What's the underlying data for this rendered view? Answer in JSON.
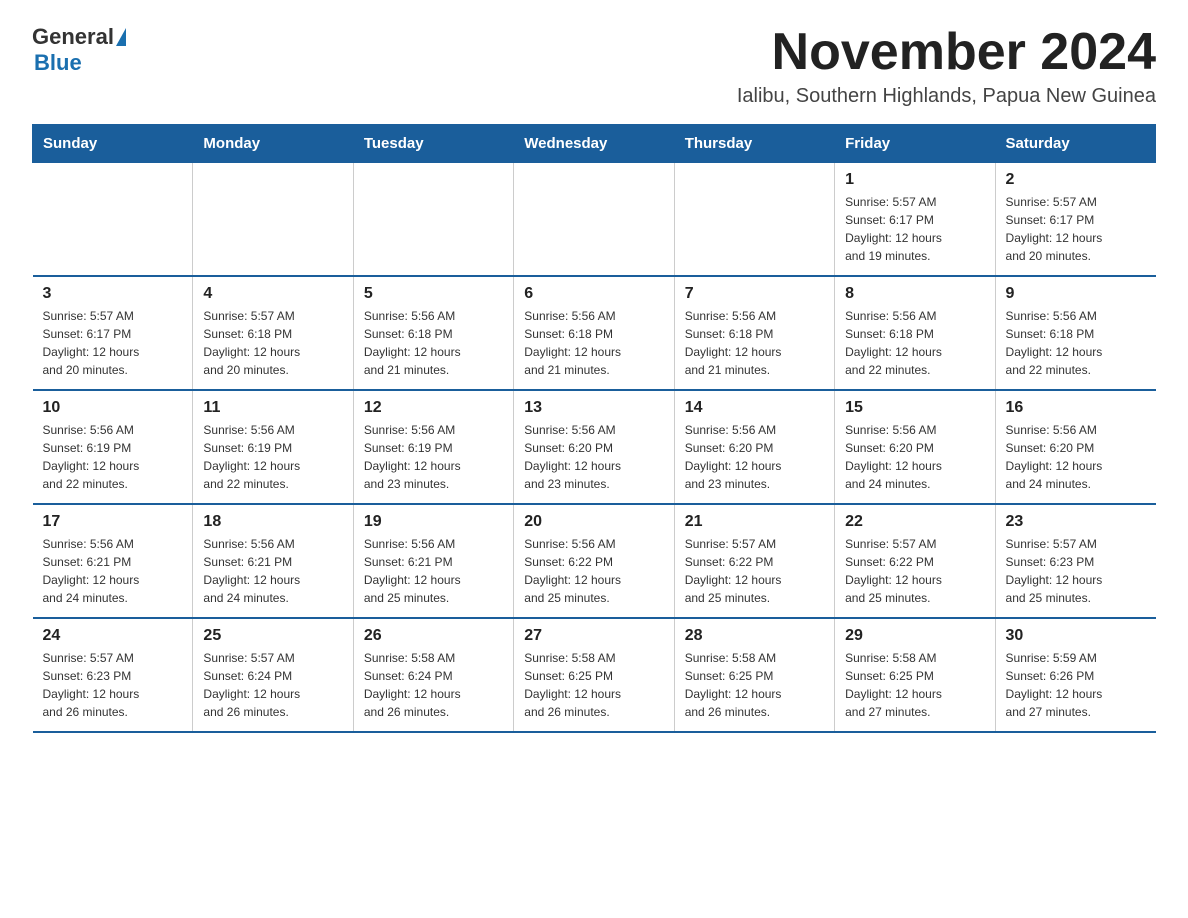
{
  "header": {
    "title": "November 2024",
    "subtitle": "Ialibu, Southern Highlands, Papua New Guinea",
    "logo_general": "General",
    "logo_blue": "Blue"
  },
  "weekdays": [
    "Sunday",
    "Monday",
    "Tuesday",
    "Wednesday",
    "Thursday",
    "Friday",
    "Saturday"
  ],
  "weeks": [
    {
      "days": [
        {
          "number": "",
          "info": ""
        },
        {
          "number": "",
          "info": ""
        },
        {
          "number": "",
          "info": ""
        },
        {
          "number": "",
          "info": ""
        },
        {
          "number": "",
          "info": ""
        },
        {
          "number": "1",
          "info": "Sunrise: 5:57 AM\nSunset: 6:17 PM\nDaylight: 12 hours\nand 19 minutes."
        },
        {
          "number": "2",
          "info": "Sunrise: 5:57 AM\nSunset: 6:17 PM\nDaylight: 12 hours\nand 20 minutes."
        }
      ]
    },
    {
      "days": [
        {
          "number": "3",
          "info": "Sunrise: 5:57 AM\nSunset: 6:17 PM\nDaylight: 12 hours\nand 20 minutes."
        },
        {
          "number": "4",
          "info": "Sunrise: 5:57 AM\nSunset: 6:18 PM\nDaylight: 12 hours\nand 20 minutes."
        },
        {
          "number": "5",
          "info": "Sunrise: 5:56 AM\nSunset: 6:18 PM\nDaylight: 12 hours\nand 21 minutes."
        },
        {
          "number": "6",
          "info": "Sunrise: 5:56 AM\nSunset: 6:18 PM\nDaylight: 12 hours\nand 21 minutes."
        },
        {
          "number": "7",
          "info": "Sunrise: 5:56 AM\nSunset: 6:18 PM\nDaylight: 12 hours\nand 21 minutes."
        },
        {
          "number": "8",
          "info": "Sunrise: 5:56 AM\nSunset: 6:18 PM\nDaylight: 12 hours\nand 22 minutes."
        },
        {
          "number": "9",
          "info": "Sunrise: 5:56 AM\nSunset: 6:18 PM\nDaylight: 12 hours\nand 22 minutes."
        }
      ]
    },
    {
      "days": [
        {
          "number": "10",
          "info": "Sunrise: 5:56 AM\nSunset: 6:19 PM\nDaylight: 12 hours\nand 22 minutes."
        },
        {
          "number": "11",
          "info": "Sunrise: 5:56 AM\nSunset: 6:19 PM\nDaylight: 12 hours\nand 22 minutes."
        },
        {
          "number": "12",
          "info": "Sunrise: 5:56 AM\nSunset: 6:19 PM\nDaylight: 12 hours\nand 23 minutes."
        },
        {
          "number": "13",
          "info": "Sunrise: 5:56 AM\nSunset: 6:20 PM\nDaylight: 12 hours\nand 23 minutes."
        },
        {
          "number": "14",
          "info": "Sunrise: 5:56 AM\nSunset: 6:20 PM\nDaylight: 12 hours\nand 23 minutes."
        },
        {
          "number": "15",
          "info": "Sunrise: 5:56 AM\nSunset: 6:20 PM\nDaylight: 12 hours\nand 24 minutes."
        },
        {
          "number": "16",
          "info": "Sunrise: 5:56 AM\nSunset: 6:20 PM\nDaylight: 12 hours\nand 24 minutes."
        }
      ]
    },
    {
      "days": [
        {
          "number": "17",
          "info": "Sunrise: 5:56 AM\nSunset: 6:21 PM\nDaylight: 12 hours\nand 24 minutes."
        },
        {
          "number": "18",
          "info": "Sunrise: 5:56 AM\nSunset: 6:21 PM\nDaylight: 12 hours\nand 24 minutes."
        },
        {
          "number": "19",
          "info": "Sunrise: 5:56 AM\nSunset: 6:21 PM\nDaylight: 12 hours\nand 25 minutes."
        },
        {
          "number": "20",
          "info": "Sunrise: 5:56 AM\nSunset: 6:22 PM\nDaylight: 12 hours\nand 25 minutes."
        },
        {
          "number": "21",
          "info": "Sunrise: 5:57 AM\nSunset: 6:22 PM\nDaylight: 12 hours\nand 25 minutes."
        },
        {
          "number": "22",
          "info": "Sunrise: 5:57 AM\nSunset: 6:22 PM\nDaylight: 12 hours\nand 25 minutes."
        },
        {
          "number": "23",
          "info": "Sunrise: 5:57 AM\nSunset: 6:23 PM\nDaylight: 12 hours\nand 25 minutes."
        }
      ]
    },
    {
      "days": [
        {
          "number": "24",
          "info": "Sunrise: 5:57 AM\nSunset: 6:23 PM\nDaylight: 12 hours\nand 26 minutes."
        },
        {
          "number": "25",
          "info": "Sunrise: 5:57 AM\nSunset: 6:24 PM\nDaylight: 12 hours\nand 26 minutes."
        },
        {
          "number": "26",
          "info": "Sunrise: 5:58 AM\nSunset: 6:24 PM\nDaylight: 12 hours\nand 26 minutes."
        },
        {
          "number": "27",
          "info": "Sunrise: 5:58 AM\nSunset: 6:25 PM\nDaylight: 12 hours\nand 26 minutes."
        },
        {
          "number": "28",
          "info": "Sunrise: 5:58 AM\nSunset: 6:25 PM\nDaylight: 12 hours\nand 26 minutes."
        },
        {
          "number": "29",
          "info": "Sunrise: 5:58 AM\nSunset: 6:25 PM\nDaylight: 12 hours\nand 27 minutes."
        },
        {
          "number": "30",
          "info": "Sunrise: 5:59 AM\nSunset: 6:26 PM\nDaylight: 12 hours\nand 27 minutes."
        }
      ]
    }
  ]
}
